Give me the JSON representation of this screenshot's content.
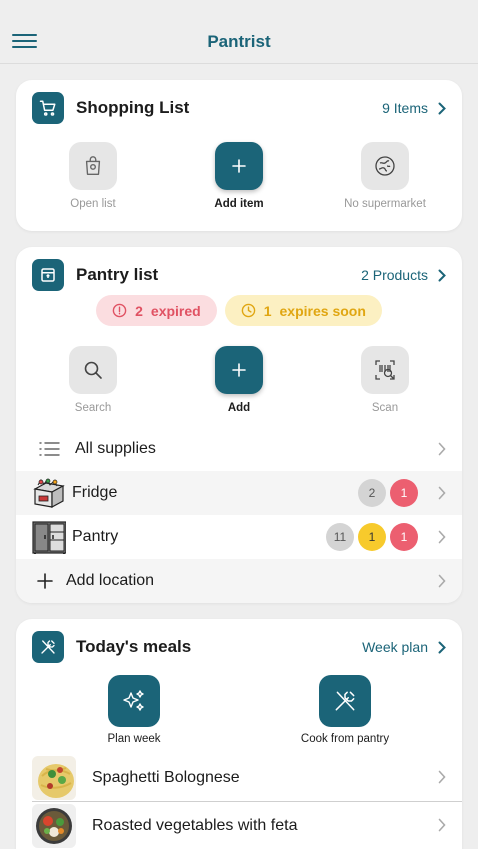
{
  "app": {
    "title": "Pantrist"
  },
  "shopping": {
    "title": "Shopping List",
    "link": "9 Items",
    "actions": {
      "open_list": "Open list",
      "add_item": "Add item",
      "no_supermarket": "No supermarket"
    }
  },
  "pantry": {
    "title": "Pantry list",
    "link": "2 Products",
    "chips": {
      "expired_count": "2",
      "expired_label": "expired",
      "soon_count": "1",
      "soon_label": "expires soon"
    },
    "actions": {
      "search": "Search",
      "add": "Add",
      "scan": "Scan"
    },
    "rows": {
      "all_supplies": "All supplies",
      "fridge": {
        "label": "Fridge",
        "badges": [
          "2",
          "1"
        ]
      },
      "pantry": {
        "label": "Pantry",
        "badges": [
          "11",
          "1",
          "1"
        ]
      },
      "add_location": "Add location"
    }
  },
  "meals": {
    "title": "Today's meals",
    "link": "Week plan",
    "actions": {
      "plan_week": "Plan week",
      "cook_from_pantry": "Cook from pantry"
    },
    "items": [
      {
        "name": "Spaghetti Bolognese"
      },
      {
        "name": "Roasted vegetables with feta"
      }
    ]
  },
  "colors": {
    "brand": "#1b6478",
    "expired": "#e05263",
    "expires_soon": "#e0a612"
  },
  "icons": {
    "menu": "hamburger-icon",
    "shopping": "cart-icon",
    "pantry": "archive-box-icon",
    "meals": "fork-knife-icon"
  }
}
